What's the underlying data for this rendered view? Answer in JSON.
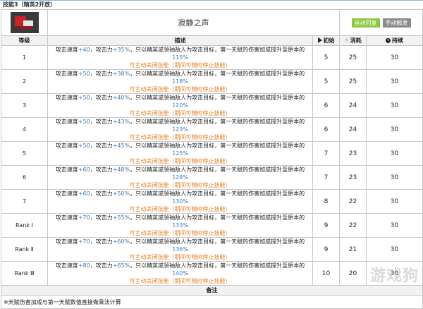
{
  "title": "技能3（精英2开放）",
  "skill": {
    "name": "寂静之声",
    "icon": "skill-icon",
    "tags": [
      "自动回复",
      "手动触发"
    ]
  },
  "columns": [
    "等级",
    "描述",
    "初始",
    "消耗",
    "持续"
  ],
  "desc_parts": {
    "a": "攻击速度",
    "b": "，攻击力",
    "c": "，只以精英或领袖敌人为攻击目标，第一天赋的伤害加成提升至原本的",
    "d": "可主动关闭技能（期间可随时停止技能）"
  },
  "rows": [
    {
      "level": "1",
      "spd": "+40",
      "atk": "+35%",
      "pct": "115%",
      "init": "5",
      "cost": "25",
      "dur": "30"
    },
    {
      "level": "2",
      "spd": "+50",
      "atk": "+38%",
      "pct": "118%",
      "init": "5",
      "cost": "25",
      "dur": "30"
    },
    {
      "level": "3",
      "spd": "+50",
      "atk": "+40%",
      "pct": "120%",
      "init": "6",
      "cost": "24",
      "dur": "30"
    },
    {
      "level": "4",
      "spd": "+50",
      "atk": "+43%",
      "pct": "123%",
      "init": "6",
      "cost": "24",
      "dur": "30"
    },
    {
      "level": "5",
      "spd": "+50",
      "atk": "+45%",
      "pct": "125%",
      "init": "7",
      "cost": "23",
      "dur": "30"
    },
    {
      "level": "6",
      "spd": "+60",
      "atk": "+48%",
      "pct": "128%",
      "init": "7",
      "cost": "23",
      "dur": "30"
    },
    {
      "level": "7",
      "spd": "+60",
      "atk": "+50%",
      "pct": "130%",
      "init": "8",
      "cost": "22",
      "dur": "30"
    },
    {
      "level": "Rank Ⅰ",
      "spd": "+70",
      "atk": "+55%",
      "pct": "133%",
      "init": "9",
      "cost": "22",
      "dur": "30"
    },
    {
      "level": "Rank Ⅱ",
      "spd": "+70",
      "atk": "+60%",
      "pct": "136%",
      "init": "9",
      "cost": "21",
      "dur": "30"
    },
    {
      "level": "Rank Ⅲ",
      "spd": "+80",
      "atk": "+65%",
      "pct": "140%",
      "init": "10",
      "cost": "20",
      "dur": "30"
    }
  ],
  "remark_title": "备注",
  "remark": "※天赋伤害加成与第一天赋数值直接做乘法计算",
  "watermark": "游戏狗",
  "colors": {
    "number": "#3f77b5",
    "orange": "#e67e22",
    "auto": "#8dc63f",
    "manual": "#8a8a8a"
  }
}
